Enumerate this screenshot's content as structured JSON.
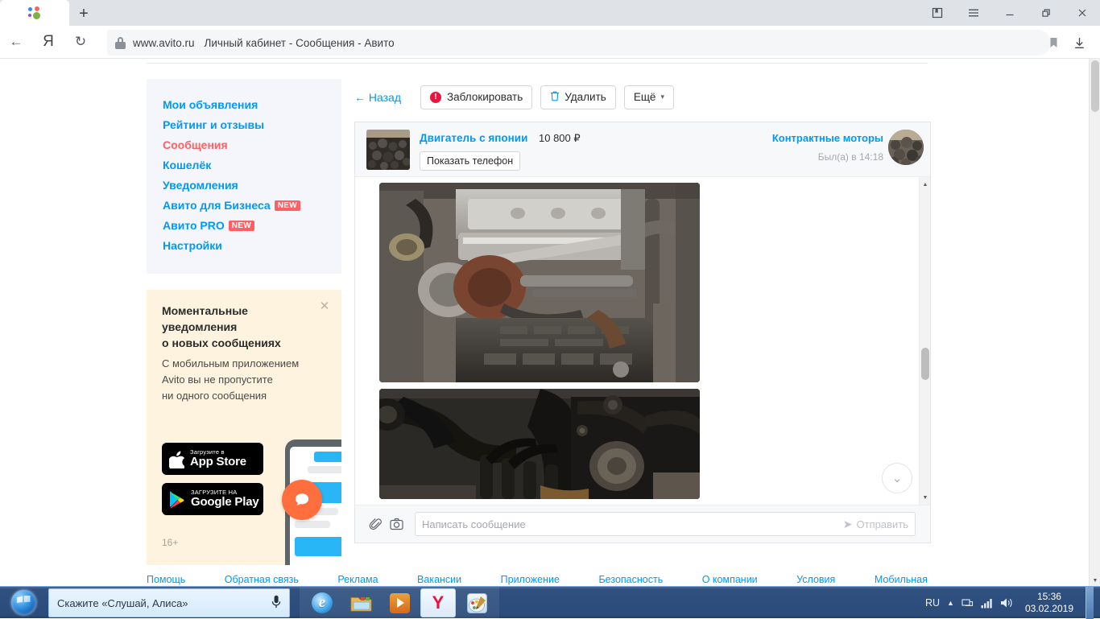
{
  "browser": {
    "tab_favicon": "avito-dots-icon",
    "newtab_label": "+",
    "url_host": "www.avito.ru",
    "url_title": "Личный кабинет - Сообщения - Авито",
    "nav": {
      "back": "←",
      "reload": "↻",
      "yandex": "Я"
    },
    "window_controls": {
      "minimize": "—",
      "restore": "❐",
      "close": "✕"
    }
  },
  "sidebar": {
    "items": [
      {
        "label": "Мои объявления",
        "active": false,
        "badge": ""
      },
      {
        "label": "Рейтинг и отзывы",
        "active": false,
        "badge": ""
      },
      {
        "label": "Сообщения",
        "active": true,
        "badge": ""
      },
      {
        "label": "Кошелёк",
        "active": false,
        "badge": ""
      },
      {
        "label": "Уведомления",
        "active": false,
        "badge": ""
      },
      {
        "label": "Авито для Бизнеса",
        "active": false,
        "badge": "NEW"
      },
      {
        "label": "Авито PRO",
        "active": false,
        "badge": "NEW"
      },
      {
        "label": "Настройки",
        "active": false,
        "badge": ""
      }
    ],
    "promo": {
      "title_line1": "Моментальные",
      "title_line2": "уведомления",
      "title_line3": "о новых сообщениях",
      "body_line1": "С мобильным приложением",
      "body_line2": "Avito вы не пропустите",
      "body_line3": "ни одного сообщения",
      "appstore_small": "Загрузите в",
      "appstore_big": "App Store",
      "gplay_small": "ЗАГРУЗИТЕ НА",
      "gplay_big": "Google Play",
      "age_rating": "16+",
      "close_label": "✕"
    }
  },
  "chat": {
    "toolbar": {
      "back": "← Назад",
      "block": "Заблокировать",
      "delete": "Удалить",
      "more": "Ещё",
      "more_caret": "▾",
      "block_icon": "!",
      "delete_icon": "🗑"
    },
    "header": {
      "item_title": "Двигатель с японии",
      "item_price": "10 800 ₽",
      "show_phone": "Показать телефон",
      "seller_name": "Контрактные моторы",
      "last_seen": "Был(а) в 14:18",
      "item_thumb_alt": "engine-thumbnail",
      "avatar_alt": "seller-avatar"
    },
    "messages": [
      {
        "type": "image",
        "alt": "engine-photo-turbo"
      },
      {
        "type": "image",
        "alt": "engine-photo-block"
      }
    ],
    "composer": {
      "placeholder": "Написать сообщение",
      "value": "",
      "send_label": "Отправить",
      "attach_icon": "📎",
      "camera_icon": "📷",
      "send_icon": "➤"
    },
    "scroll_down_icon": "⌄"
  },
  "footer": {
    "links": [
      "Помощь",
      "Обратная связь",
      "Реклама",
      "Вакансии",
      "Приложение",
      "Безопасность",
      "О компании",
      "Условия",
      "Мобильная"
    ]
  },
  "taskbar": {
    "alice_text": "Скажите «Слушай, Алиса»",
    "mic_icon": "microphone-icon",
    "apps": [
      {
        "name": "internet-explorer",
        "active": false
      },
      {
        "name": "explorer-folder",
        "active": false
      },
      {
        "name": "windows-media-player",
        "active": false
      },
      {
        "name": "yandex-browser",
        "active": true
      },
      {
        "name": "paint",
        "active": false
      }
    ],
    "tray": {
      "language": "RU",
      "show_hidden": "▲",
      "network_icon": "network-icon",
      "signal_icon": "signal-bars-icon",
      "volume_icon": "volume-icon",
      "time": "15:36",
      "date": "03.02.2019"
    }
  }
}
